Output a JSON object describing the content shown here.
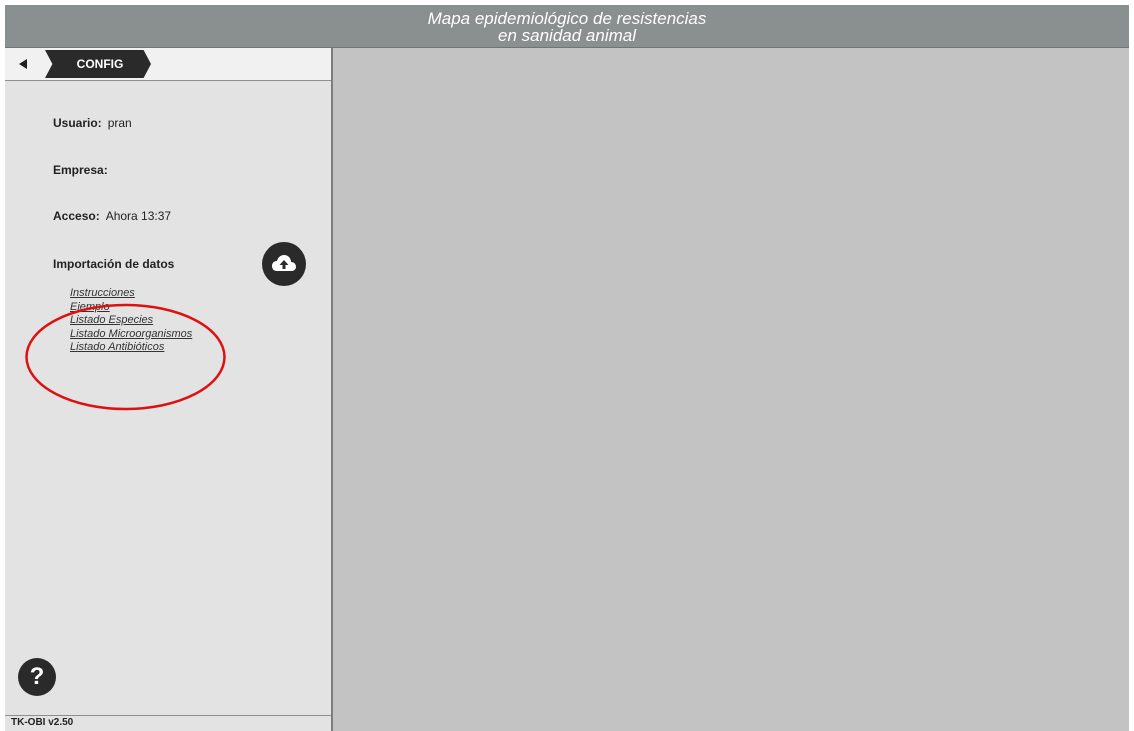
{
  "header": {
    "title_line1": "Mapa epidemiológico de resistencias",
    "title_line2": "en sanidad animal"
  },
  "sidebar": {
    "tab_label": "CONFIG",
    "usuario": {
      "label": "Usuario:",
      "value": "pran"
    },
    "empresa": {
      "label": "Empresa:",
      "value": ""
    },
    "acceso": {
      "label": "Acceso:",
      "value": "Ahora 13:37"
    },
    "importacion": {
      "label": "Importación de datos"
    },
    "links": [
      "Instrucciones",
      "Ejemplo",
      "Listado Especies",
      "Listado Microorganismos",
      "Listado Antibióticos"
    ],
    "help_label": "?",
    "version": "TK-OBI v2.50"
  },
  "colors": {
    "header_bg": "#8a8f8f",
    "panel_bg": "#e3e3e3",
    "main_bg": "#c3c3c3",
    "dark_button": "#2a2a2a",
    "annotation_red": "#dd1111"
  },
  "icons": [
    "back-arrow-icon",
    "cloud-upload-icon",
    "help-icon"
  ]
}
